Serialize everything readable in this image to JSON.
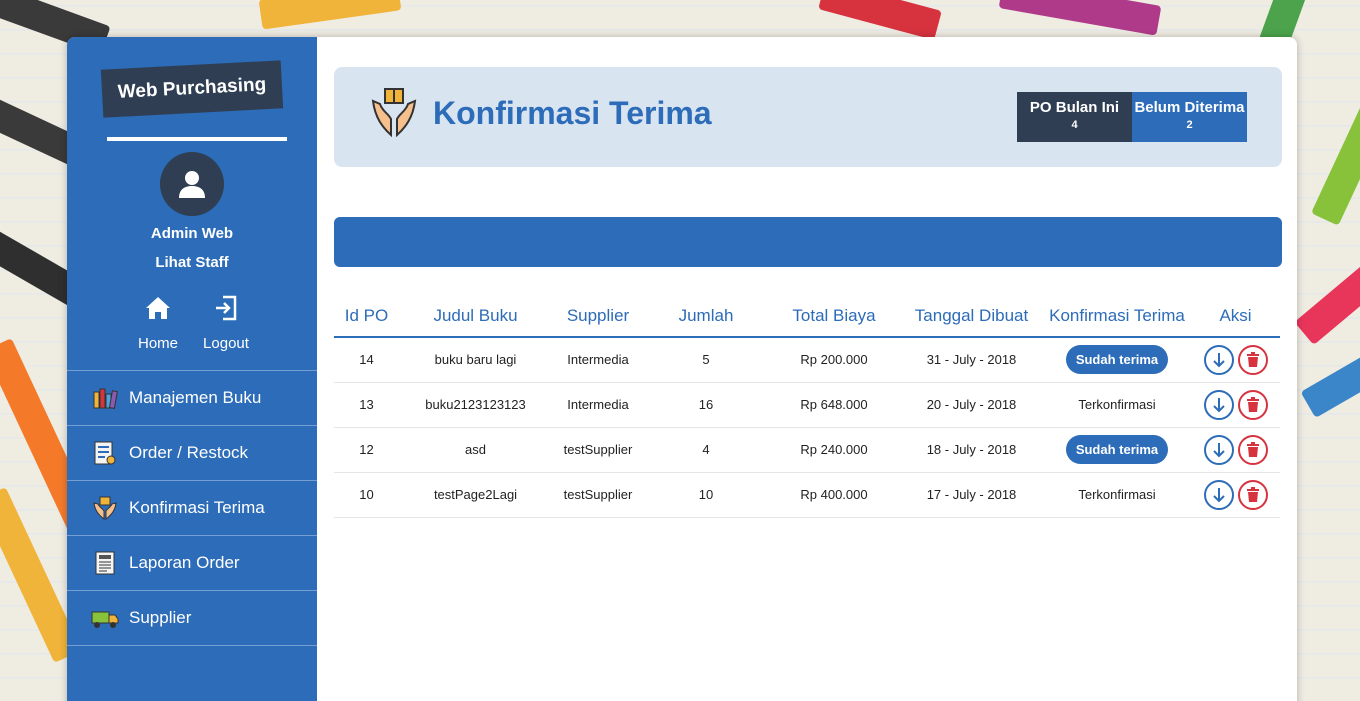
{
  "sidebar": {
    "brand": "Web Purchasing",
    "user_name": "Admin Web",
    "view_staff": "Lihat Staff",
    "home_label": "Home",
    "logout_label": "Logout",
    "menu": [
      {
        "label": "Manajemen Buku",
        "icon": "books-icon"
      },
      {
        "label": "Order / Restock",
        "icon": "order-form-icon"
      },
      {
        "label": "Konfirmasi Terima",
        "icon": "hands-book-icon"
      },
      {
        "label": "Laporan Order",
        "icon": "report-icon"
      },
      {
        "label": "Supplier",
        "icon": "truck-icon"
      }
    ]
  },
  "header": {
    "title": "Konfirmasi Terima",
    "stats": [
      {
        "label": "PO Bulan Ini",
        "value": "4"
      },
      {
        "label": "Belum Diterima",
        "value": "2"
      }
    ]
  },
  "table": {
    "columns": [
      "Id PO",
      "Judul Buku",
      "Supplier",
      "Jumlah",
      "Total Biaya",
      "Tanggal Dibuat",
      "Konfirmasi Terima",
      "Aksi"
    ],
    "rows": [
      {
        "id": "14",
        "title": "buku baru lagi",
        "supplier": "Intermedia",
        "qty": "5",
        "total": "Rp 200.000",
        "date": "31 - July - 2018",
        "status": "Sudah terima",
        "status_is_button": true
      },
      {
        "id": "13",
        "title": "buku2123123123",
        "supplier": "Intermedia",
        "qty": "16",
        "total": "Rp 648.000",
        "date": "20 - July - 2018",
        "status": "Terkonfirmasi",
        "status_is_button": false
      },
      {
        "id": "12",
        "title": "asd",
        "supplier": "testSupplier",
        "qty": "4",
        "total": "Rp 240.000",
        "date": "18 - July - 2018",
        "status": "Sudah terima",
        "status_is_button": true
      },
      {
        "id": "10",
        "title": "testPage2Lagi",
        "supplier": "testSupplier",
        "qty": "10",
        "total": "Rp 400.000",
        "date": "17 - July - 2018",
        "status": "Terkonfirmasi",
        "status_is_button": false
      }
    ]
  },
  "colors": {
    "primary": "#2c6cb8",
    "dark": "#2f3e52",
    "header_bg": "#d9e4f1",
    "danger": "#d6333f"
  }
}
